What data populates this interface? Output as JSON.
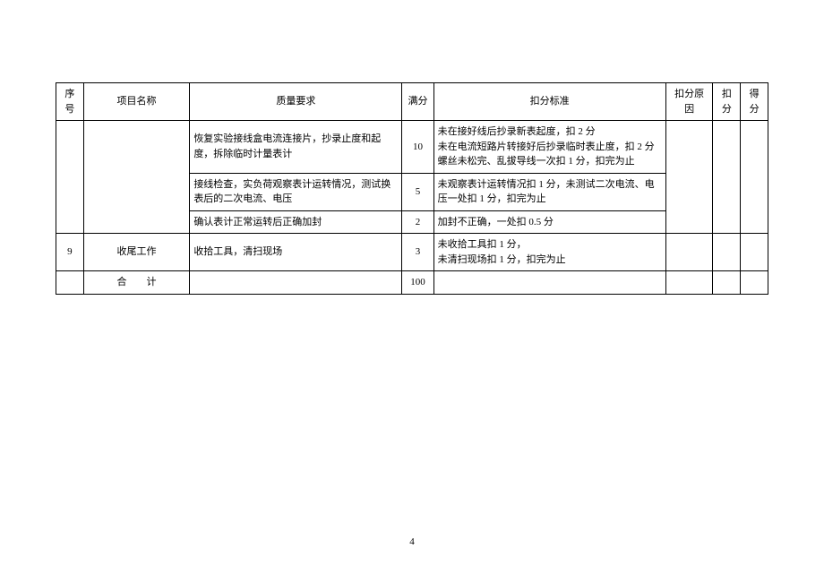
{
  "headers": {
    "seq": "序号",
    "name": "项目名称",
    "req": "质量要求",
    "full": "满分",
    "std": "扣分标准",
    "reason": "扣分原因",
    "deduct": "扣分",
    "score": "得分"
  },
  "rows": {
    "r1": {
      "seq": "",
      "name": "",
      "req": "恢复实验接线盒电流连接片，抄录止度和起度，拆除临时计量表计",
      "full": "10",
      "std": "未在接好线后抄录新表起度，扣 2 分\n未在电流短路片转接好后抄录临时表止度，扣 2 分\n螺丝未松完、乱拔导线一次扣 1 分，扣完为止",
      "reason": "",
      "deduct": "",
      "score": ""
    },
    "r2": {
      "req": "接线检查，实负荷观察表计运转情况，测试换表后的二次电流、电压",
      "full": "5",
      "std": "未观察表计运转情况扣 1 分，未测试二次电流、电压一处扣 1 分，扣完为止"
    },
    "r3": {
      "req": "确认表计正常运转后正确加封",
      "full": "2",
      "std": "加封不正确，一处扣 0.5 分"
    },
    "r4": {
      "seq": "9",
      "name": "收尾工作",
      "req": "收拾工具，清扫现场",
      "full": "3",
      "std": "未收拾工具扣 1 分，\n未清扫现场扣 1 分，扣完为止",
      "reason": "",
      "deduct": "",
      "score": ""
    },
    "total": {
      "seq": "",
      "name": "合　　计",
      "req": "",
      "full": "100",
      "std": "",
      "reason": "",
      "deduct": "",
      "score": ""
    }
  },
  "page_number": "4"
}
